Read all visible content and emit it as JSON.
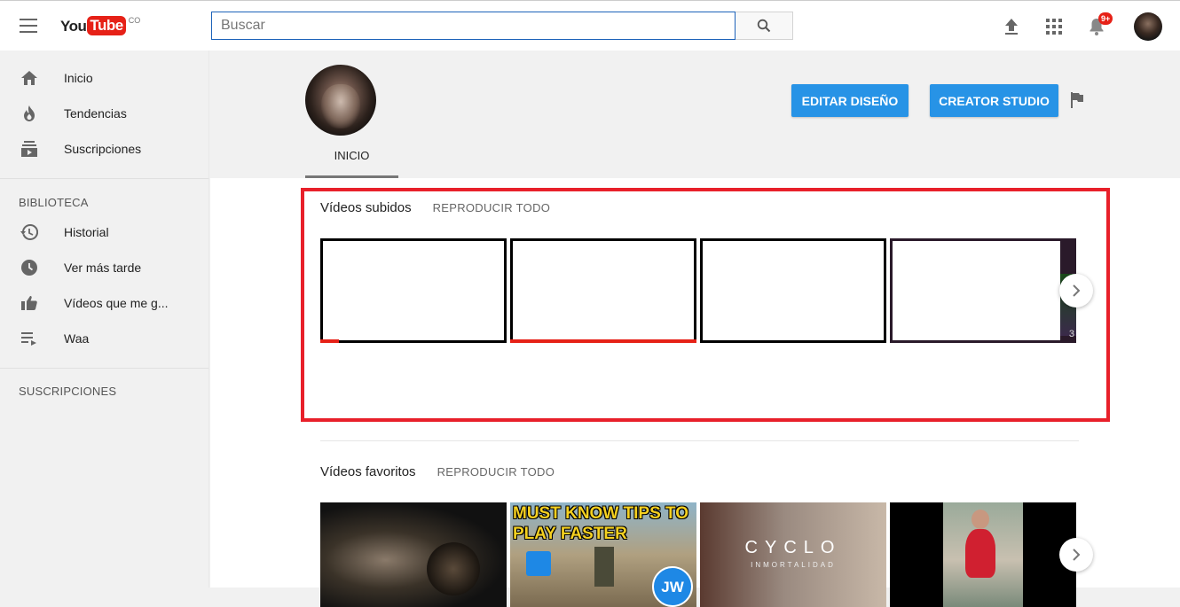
{
  "header": {
    "logo_you": "You",
    "logo_tube": "Tube",
    "logo_country": "CO",
    "search_placeholder": "Buscar",
    "notifications_badge": "9+",
    "icons": [
      "menu-icon",
      "search-icon",
      "upload-icon",
      "apps-icon",
      "bell-icon"
    ]
  },
  "sidebar": {
    "main_items": [
      {
        "label": "Inicio",
        "icon": "home-icon"
      },
      {
        "label": "Tendencias",
        "icon": "fire-icon"
      },
      {
        "label": "Suscripciones",
        "icon": "subscriptions-icon"
      }
    ],
    "library_title": "BIBLIOTECA",
    "library_items": [
      {
        "label": "Historial",
        "icon": "history-icon"
      },
      {
        "label": "Ver más tarde",
        "icon": "clock-icon"
      },
      {
        "label": "Vídeos que me g...",
        "icon": "thumb-up-icon"
      },
      {
        "label": "Waa",
        "icon": "playlist-icon"
      }
    ],
    "subscriptions_title": "SUSCRIPCIONES"
  },
  "channel": {
    "tab_label": "INICIO",
    "edit_button": "EDITAR DISEÑO",
    "studio_button": "CREATOR STUDIO"
  },
  "uploaded": {
    "title": "Vídeos subidos",
    "play_all": "REPRODUCIR TODO",
    "badge_fragment": "3",
    "progress": [
      0.1,
      1.0,
      0.0,
      0.0
    ]
  },
  "favorites": {
    "title": "Vídeos favoritos",
    "play_all": "REPRODUCIR TODO",
    "thumb2_text": "MUST KNOW TIPS TO PLAY FASTER",
    "thumb2_badge": "JW",
    "thumb3_title": "CYCLO",
    "thumb3_subtitle": "INMORTALIDAD"
  },
  "colors": {
    "accent_blue": "#2793e6",
    "youtube_red": "#e62117",
    "highlight_red": "#e8202a"
  }
}
